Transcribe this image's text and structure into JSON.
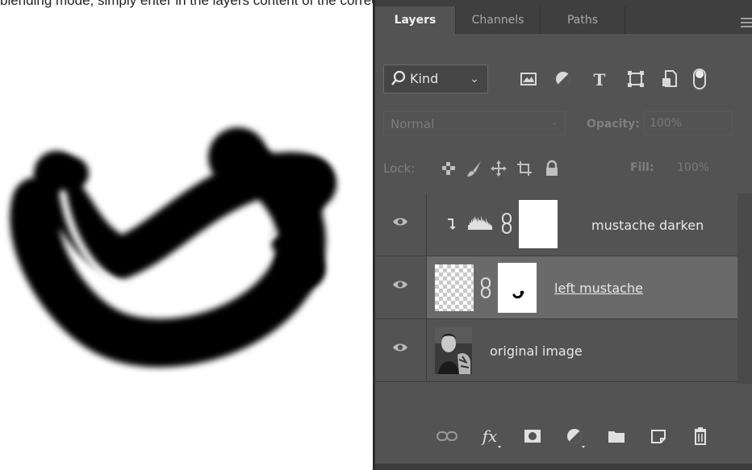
{
  "page_caption": "blending mode, simply enter in the layers content of the correct",
  "tabs": [
    {
      "label": "Layers",
      "active": true
    },
    {
      "label": "Channels",
      "active": false
    },
    {
      "label": "Paths",
      "active": false
    }
  ],
  "filter": {
    "kind_label": "Kind",
    "icons": [
      "image-filter-icon",
      "adjustment-filter-icon",
      "type-filter-icon",
      "shape-filter-icon",
      "smart-object-filter-icon"
    ]
  },
  "blend": {
    "mode": "Normal",
    "opacity_label": "Opacity:",
    "opacity_value": "100%"
  },
  "lock": {
    "label": "Lock:",
    "fill_label": "Fill:",
    "fill_value": "100%"
  },
  "layers": [
    {
      "name": "mustache darken",
      "type": "adjustment",
      "clipped": true,
      "visible": true,
      "selected": false
    },
    {
      "name": "left mustache",
      "type": "masked",
      "visible": true,
      "selected": true
    },
    {
      "name": "original image",
      "type": "image",
      "visible": true,
      "selected": false
    }
  ],
  "colors": {
    "panel_bg": "#535353",
    "tab_bar": "#3f3f3f",
    "selected_row": "#6a6a6a",
    "canvas_bg": "#ffffff",
    "brush": "#000000"
  }
}
